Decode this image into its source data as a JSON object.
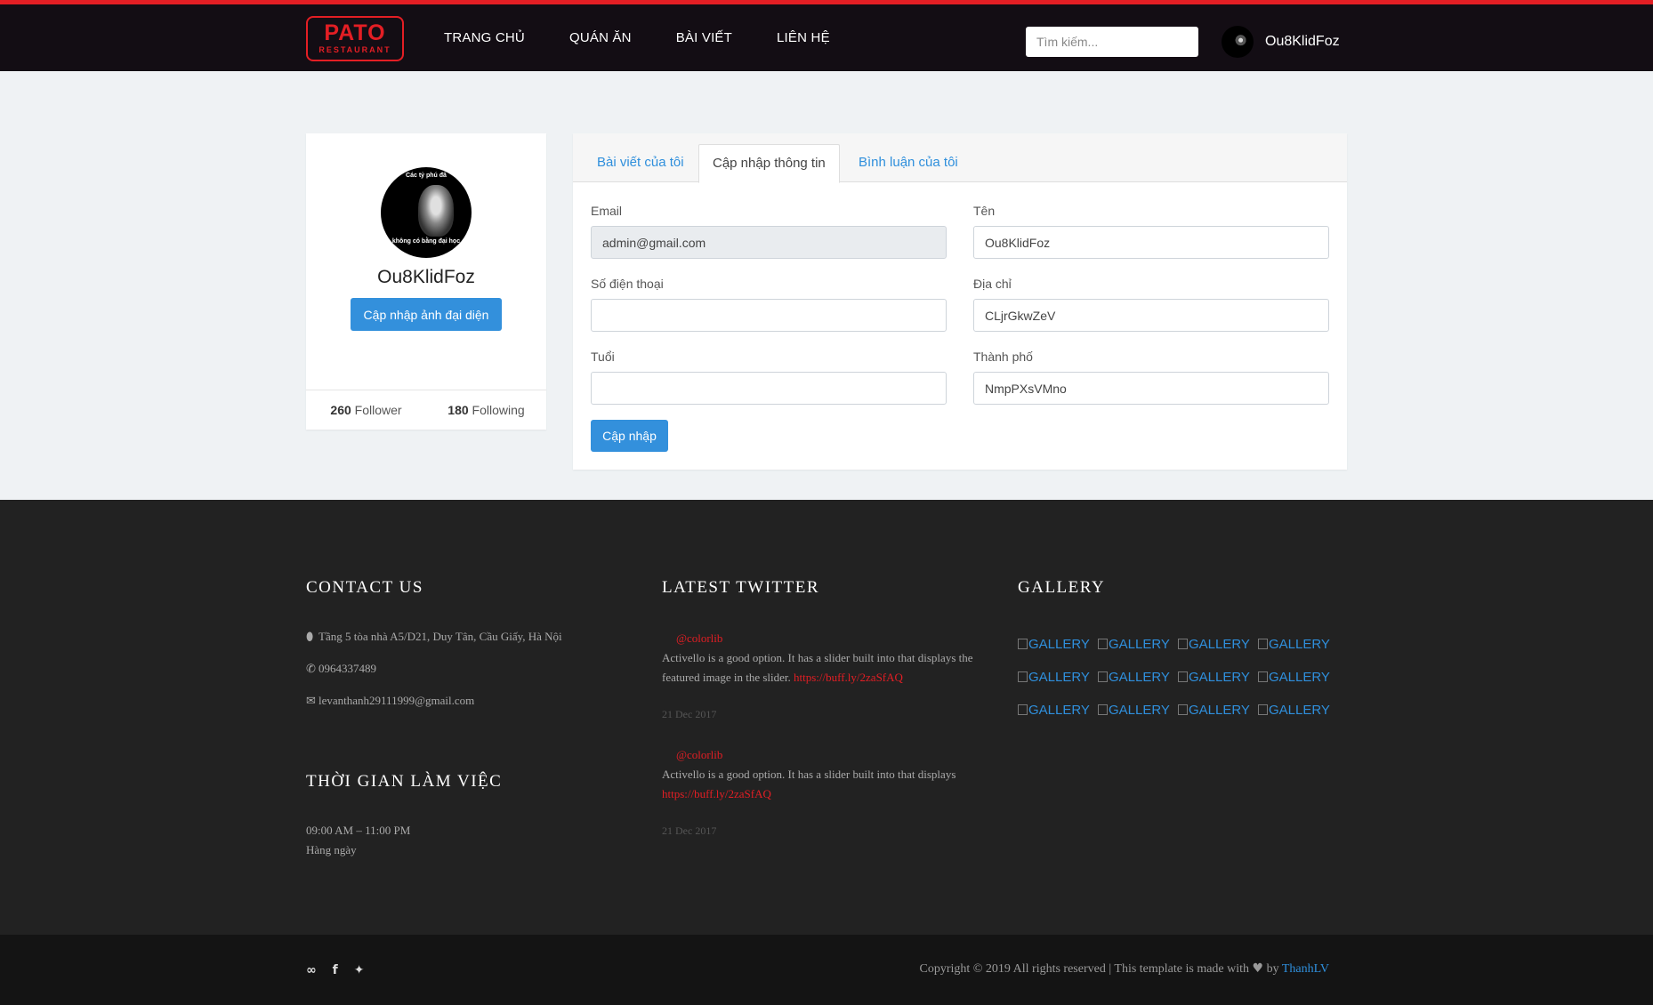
{
  "header": {
    "logo_main": "PATO",
    "logo_sub": "RESTAURANT",
    "nav": [
      "TRANG CHỦ",
      "QUÁN ĂN",
      "BÀI VIẾT",
      "LIÊN HỆ"
    ],
    "search_placeholder": "Tìm kiếm...",
    "username": "Ou8KlidFoz"
  },
  "profile": {
    "avatar_caption_top": "Các tỷ phú đã",
    "avatar_caption_bottom": "không có bằng đại học",
    "name": "Ou8KlidFoz",
    "update_avatar_label": "Cập nhập ảnh đại diện",
    "followers_count": "260",
    "followers_label": "Follower",
    "following_count": "180",
    "following_label": "Following"
  },
  "tabs": [
    "Bài viết của tôi",
    "Cập nhập thông tin",
    "Bình luận của tôi"
  ],
  "form": {
    "email_label": "Email",
    "email_value": "admin@gmail.com",
    "name_label": "Tên",
    "name_value": "Ou8KlidFoz",
    "phone_label": "Số điện thoại",
    "phone_value": "",
    "address_label": "Địa chỉ",
    "address_value": "CLjrGkwZeV",
    "age_label": "Tuổi",
    "age_value": "",
    "city_label": "Thành phố",
    "city_value": "NmpPXsVMno",
    "submit_label": "Cập nhập"
  },
  "footer": {
    "contact_title": "CONTACT US",
    "address": "Tầng 5 tòa nhà A5/D21, Duy Tân, Cầu Giấy, Hà Nội",
    "phone": "0964337489",
    "email": "levanthanh29111999@gmail.com",
    "hours_title": "THỜI GIAN LÀM VIỆC",
    "hours": "09:00 AM – 11:00 PM",
    "hours_note": "Hàng ngày",
    "twitter_title": "LATEST TWITTER",
    "tweets": [
      {
        "handle": "@colorlib",
        "text": "Activello is a good option. It has a slider built into that displays the featured image in the slider.",
        "link": "https://buff.ly/2zaSfAQ",
        "date": "21 Dec 2017"
      },
      {
        "handle": "@colorlib",
        "text": "Activello is a good option. It has a slider built into that displays",
        "link": "https://buff.ly/2zaSfAQ",
        "date": "21 Dec 2017"
      }
    ],
    "gallery_title": "GALLERY",
    "gallery_alt": "GALLERY",
    "copyright_text": "Copyright © 2019 All rights reserved | This template is made with",
    "copyright_by": "by",
    "copyright_author": "ThanhLV"
  },
  "icons": {
    "heart": "heart-icon",
    "map_marker": "map-marker-icon",
    "phone": "phone-icon",
    "envelope": "envelope-icon"
  },
  "colors": {
    "brand_red": "#e31e24",
    "primary_blue": "#3390dc",
    "header_bg": "#130d14",
    "footer_bg": "#222222"
  }
}
